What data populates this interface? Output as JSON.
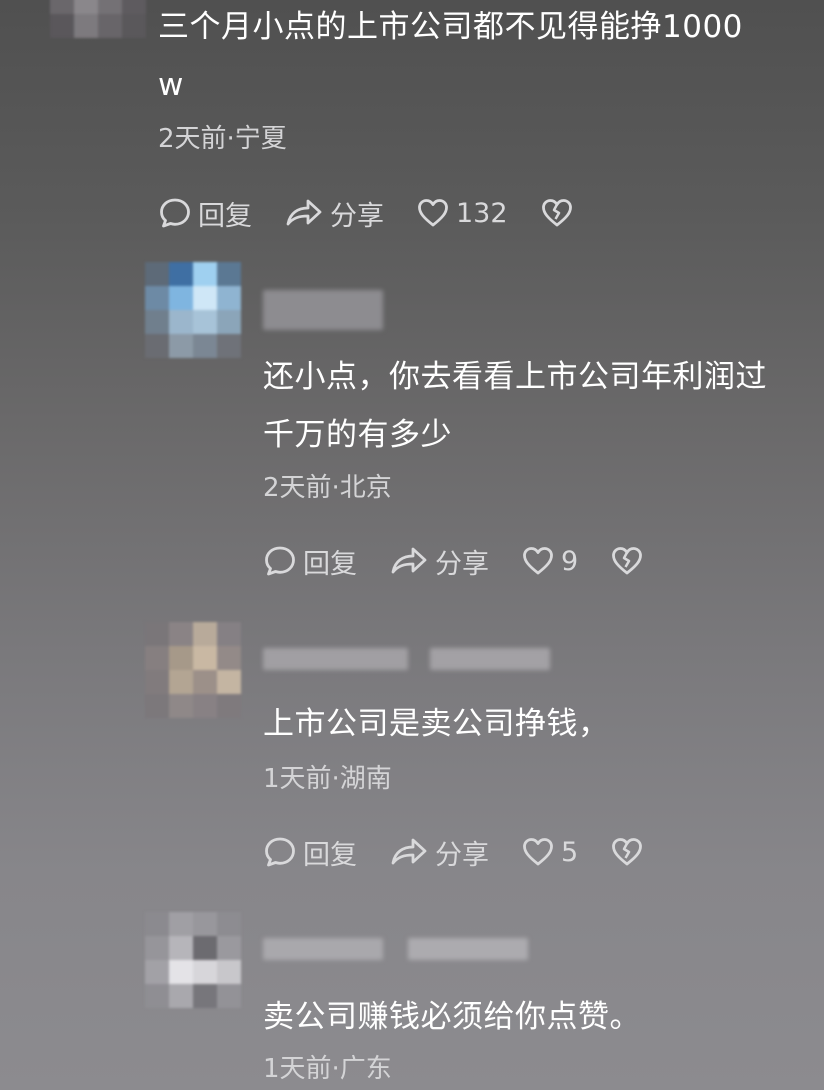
{
  "comments": [
    {
      "lines": [
        "三个月小点的上市公司都不见得能挣1000",
        "w"
      ],
      "meta": "2天前·宁夏",
      "reply_label": "回复",
      "share_label": "分享",
      "like_count": "132"
    },
    {
      "lines": [
        "还小点，你去看看上市公司年利润过",
        "千万的有多少"
      ],
      "meta": "2天前·北京",
      "reply_label": "回复",
      "share_label": "分享",
      "like_count": "9"
    },
    {
      "lines": [
        "上市公司是卖公司挣钱，"
      ],
      "meta": "1天前·湖南",
      "reply_label": "回复",
      "share_label": "分享",
      "like_count": "5"
    },
    {
      "lines": [
        "卖公司赚钱必须给你点赞。"
      ],
      "meta": "1天前·广东"
    }
  ],
  "icons": {
    "reply": "speech-bubble-icon",
    "share": "share-arrow-icon",
    "like": "heart-outline-icon",
    "dislike": "broken-heart-icon"
  },
  "colors": {
    "text": "#ffffff",
    "meta": "#d4d4d6",
    "action": "#d9d9db"
  }
}
